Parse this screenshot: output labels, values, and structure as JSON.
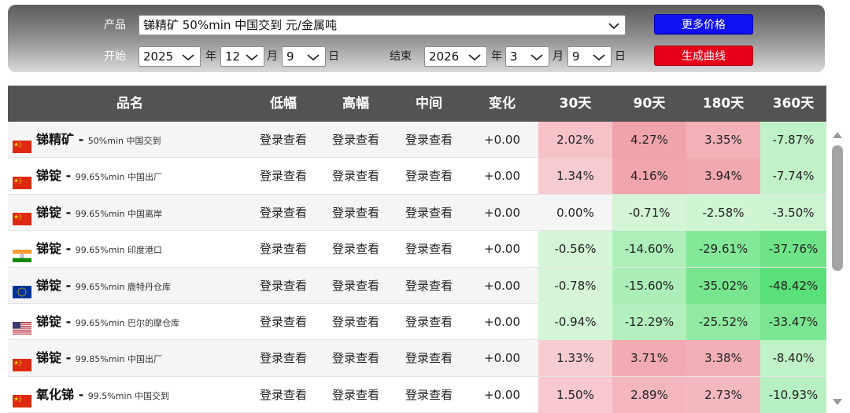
{
  "filter": {
    "product_label": "产品",
    "product_value": "锑精矿 50%min 中国交到 元/金属吨",
    "start_label": "开始",
    "end_label": "结束",
    "start_year": "2025",
    "start_month": "12",
    "start_day": "9",
    "end_year": "2026",
    "end_month": "3",
    "end_day": "9",
    "year_unit": "年",
    "month_unit": "月",
    "day_unit": "日",
    "more_prices_label": "更多价格",
    "generate_curve_label": "生成曲线",
    "more_prices_color": "#1010f0",
    "generate_curve_color": "#e6001a"
  },
  "table": {
    "headers": {
      "name": "品名",
      "low": "低幅",
      "high": "高幅",
      "mid": "中间",
      "change": "变化",
      "d30": "30天",
      "d90": "90天",
      "d180": "180天",
      "d360": "360天"
    },
    "rows": [
      {
        "flag": "cn-flag",
        "name": "锑精矿",
        "sep": " - ",
        "spec": "50%min 中国交到",
        "low": "登录查看",
        "high": "登录查看",
        "mid": "登录查看",
        "change": "+0.00",
        "d30": "2.02%",
        "d90": "4.27%",
        "d180": "3.35%",
        "d360": "-7.87%"
      },
      {
        "flag": "cn-flag",
        "name": "锑锭",
        "sep": " - ",
        "spec": "99.65%min 中国出厂",
        "low": "登录查看",
        "high": "登录查看",
        "mid": "登录查看",
        "change": "+0.00",
        "d30": "1.34%",
        "d90": "4.16%",
        "d180": "3.94%",
        "d360": "-7.74%"
      },
      {
        "flag": "cn-flag",
        "name": "锑锭",
        "sep": " - ",
        "spec": "99.65%min 中国离岸",
        "low": "登录查看",
        "high": "登录查看",
        "mid": "登录查看",
        "change": "+0.00",
        "d30": "0.00%",
        "d90": "-0.71%",
        "d180": "-2.58%",
        "d360": "-3.50%"
      },
      {
        "flag": "in-flag",
        "name": "锑锭",
        "sep": " - ",
        "spec": "99.65%min 印度港口",
        "low": "登录查看",
        "high": "登录查看",
        "mid": "登录查看",
        "change": "+0.00",
        "d30": "-0.56%",
        "d90": "-14.60%",
        "d180": "-29.61%",
        "d360": "-37.76%"
      },
      {
        "flag": "eu-flag",
        "name": "锑锭",
        "sep": " - ",
        "spec": "99.65%min 鹿特丹仓库",
        "low": "登录查看",
        "high": "登录查看",
        "mid": "登录查看",
        "change": "+0.00",
        "d30": "-0.78%",
        "d90": "-15.60%",
        "d180": "-35.02%",
        "d360": "-48.42%"
      },
      {
        "flag": "us-flag",
        "name": "锑锭",
        "sep": " - ",
        "spec": "99.65%min 巴尔的摩仓库",
        "low": "登录查看",
        "high": "登录查看",
        "mid": "登录查看",
        "change": "+0.00",
        "d30": "-0.94%",
        "d90": "-12.29%",
        "d180": "-25.52%",
        "d360": "-33.47%"
      },
      {
        "flag": "cn-flag",
        "name": "锑锭",
        "sep": " - ",
        "spec": "99.85%min 中国出厂",
        "low": "登录查看",
        "high": "登录查看",
        "mid": "登录查看",
        "change": "+0.00",
        "d30": "1.33%",
        "d90": "3.71%",
        "d180": "3.38%",
        "d360": "-8.40%"
      },
      {
        "flag": "cn-flag",
        "name": "氧化锑",
        "sep": " - ",
        "spec": "99.5%min 中国交到",
        "low": "登录查看",
        "high": "登录查看",
        "mid": "登录查看",
        "change": "+0.00",
        "d30": "1.50%",
        "d90": "2.89%",
        "d180": "2.73%",
        "d360": "-10.93%"
      }
    ]
  },
  "colors": {
    "header_bg": "#535353",
    "positive_accent": "#f0a0a8",
    "negative_accent": "#5ad47a"
  }
}
